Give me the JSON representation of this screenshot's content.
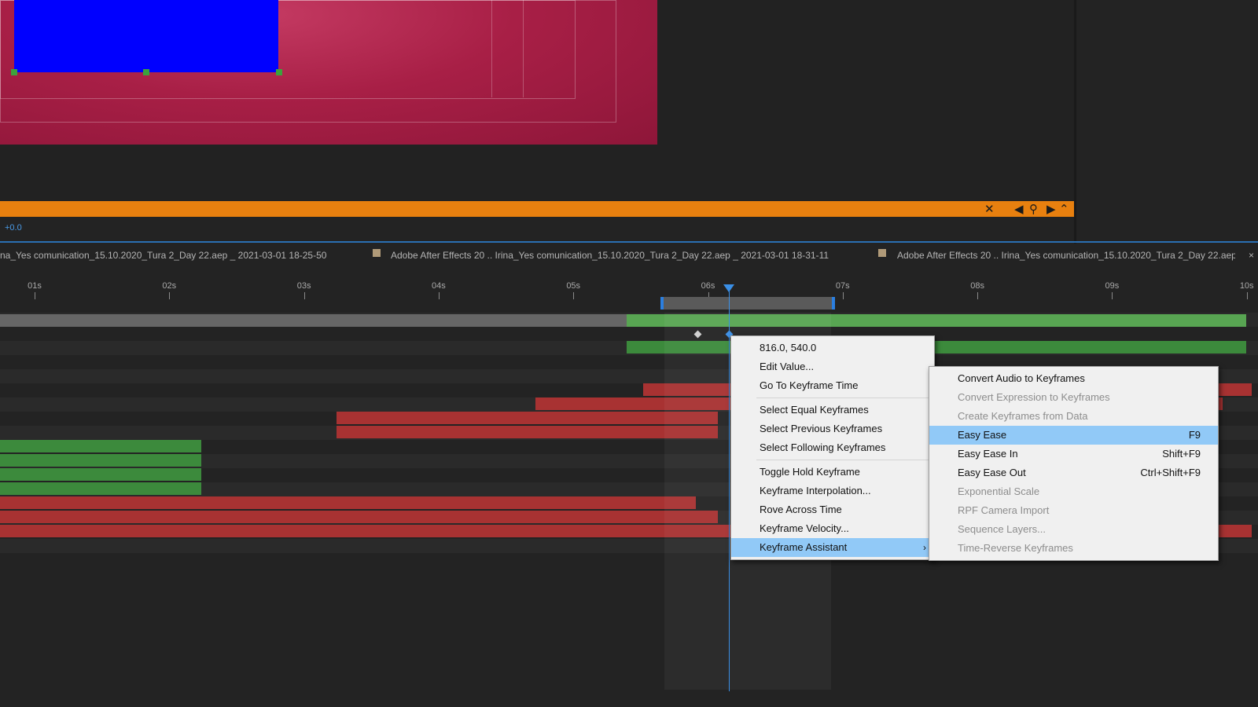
{
  "colors": {
    "accent_orange": "#e8800f",
    "cti_blue": "#3a8fe6",
    "menu_highlight": "#91c9f7",
    "keyframe_green": "#3c8a3c",
    "keyframe_red": "#a83232"
  },
  "viewer": {
    "offset_readout": "+0.0"
  },
  "orange_bar": {
    "icons": [
      "close-icon",
      "prev-icon",
      "search-icon",
      "next-icon",
      "collapse-icon"
    ]
  },
  "tabs": [
    {
      "label": "na_Yes comunication_15.10.2020_Tura 2_Day 22.aep _ 2021-03-01 18-25-50"
    },
    {
      "label": "Adobe After Effects 20 .. Irina_Yes comunication_15.10.2020_Tura 2_Day 22.aep _ 2021-03-01 18-31-11"
    },
    {
      "label": "Adobe After Effects 20 .. Irina_Yes comunication_15.10.2020_Tura 2_Day 22.aep"
    }
  ],
  "tabs_close": "×",
  "ruler": {
    "ticks": [
      "01s",
      "02s",
      "03s",
      "04s",
      "05s",
      "06s",
      "07s",
      "08s",
      "09s",
      "10s"
    ],
    "current_time_seconds": 6.15
  },
  "context_menu": {
    "items": [
      {
        "label": "816.0, 540.0"
      },
      {
        "label": "Edit Value..."
      },
      {
        "label": "Go To Keyframe Time"
      },
      {
        "label": "Select Equal Keyframes"
      },
      {
        "label": "Select Previous Keyframes"
      },
      {
        "label": "Select Following Keyframes"
      },
      {
        "label": "Toggle Hold Keyframe"
      },
      {
        "label": "Keyframe Interpolation..."
      },
      {
        "label": "Rove Across Time"
      },
      {
        "label": "Keyframe Velocity..."
      },
      {
        "label": "Keyframe Assistant",
        "submenu_arrow": "›"
      }
    ]
  },
  "submenu": {
    "items": [
      {
        "label": "Convert Audio to Keyframes",
        "shortcut": ""
      },
      {
        "label": "Convert Expression to Keyframes",
        "shortcut": ""
      },
      {
        "label": "Create Keyframes from Data",
        "shortcut": ""
      },
      {
        "label": "Easy Ease",
        "shortcut": "F9"
      },
      {
        "label": "Easy Ease In",
        "shortcut": "Shift+F9"
      },
      {
        "label": "Easy Ease Out",
        "shortcut": "Ctrl+Shift+F9"
      },
      {
        "label": "Exponential Scale",
        "shortcut": ""
      },
      {
        "label": "RPF Camera Import",
        "shortcut": ""
      },
      {
        "label": "Sequence Layers...",
        "shortcut": ""
      },
      {
        "label": "Time-Reverse Keyframes",
        "shortcut": ""
      }
    ]
  }
}
